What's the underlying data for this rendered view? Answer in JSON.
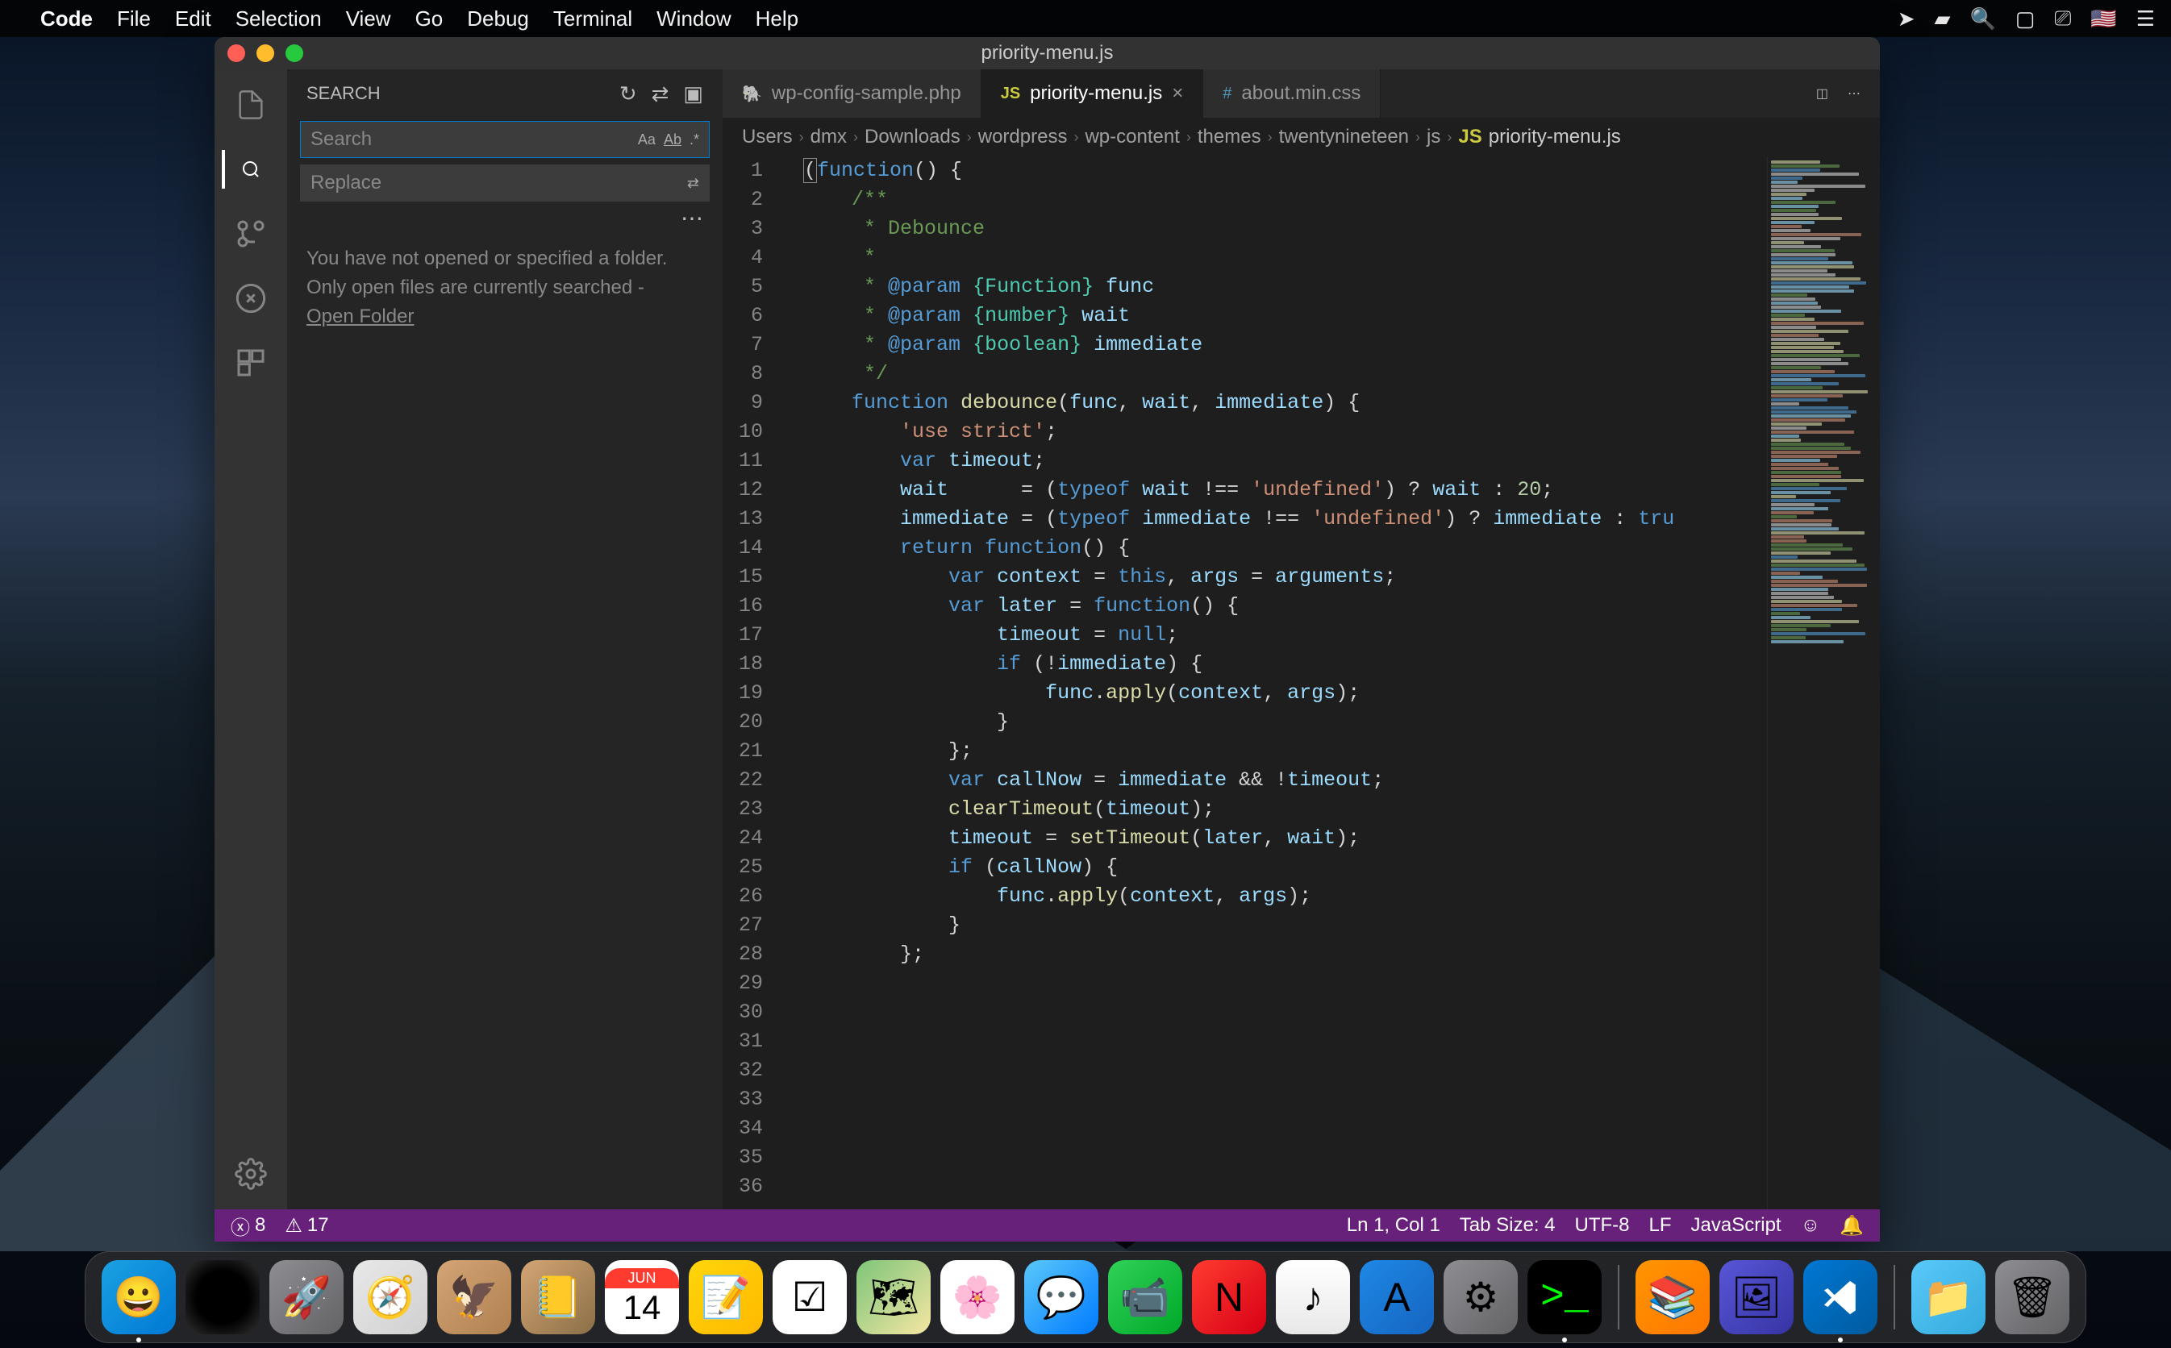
{
  "macos_menubar": {
    "app_name": "Code",
    "items": [
      "File",
      "Edit",
      "Selection",
      "View",
      "Go",
      "Debug",
      "Terminal",
      "Window",
      "Help"
    ]
  },
  "window": {
    "title": "priority-menu.js"
  },
  "sidebar": {
    "title": "SEARCH",
    "search_placeholder": "Search",
    "replace_placeholder": "Replace",
    "message_line1": "You have not opened or specified a folder.",
    "message_line2": "Only open files are currently searched -",
    "open_folder_link": "Open Folder"
  },
  "tabs": [
    {
      "icon": "php",
      "label": "wp-config-sample.php",
      "active": false
    },
    {
      "icon": "js",
      "label": "priority-menu.js",
      "active": true,
      "close": true
    },
    {
      "icon": "css",
      "label": "about.min.css",
      "active": false
    }
  ],
  "breadcrumbs": [
    "Users",
    "dmx",
    "Downloads",
    "wordpress",
    "wp-content",
    "themes",
    "twentynineteen",
    "js",
    "priority-menu.js"
  ],
  "breadcrumb_file_icon": "JS",
  "line_numbers": [
    "1",
    "2",
    "3",
    "4",
    "5",
    "6",
    "7",
    "8",
    "9",
    "10",
    "11",
    "12",
    "13",
    "14",
    "15",
    "16",
    "17",
    "18",
    "19",
    "20",
    "21",
    "22",
    "23",
    "24",
    "25",
    "26",
    "27",
    "28",
    "29",
    "30",
    "31",
    "32",
    "33",
    "34",
    "35",
    "36"
  ],
  "code_lines": [
    {
      "tokens": [
        {
          "t": "(",
          "c": "bracket-highlight"
        },
        {
          "t": "function",
          "c": "tok-keyword"
        },
        {
          "t": "() {",
          "c": ""
        }
      ]
    },
    {
      "tokens": [
        {
          "t": "",
          "c": ""
        }
      ]
    },
    {
      "tokens": [
        {
          "t": "    /**",
          "c": "tok-comment"
        }
      ]
    },
    {
      "tokens": [
        {
          "t": "     * Debounce",
          "c": "tok-comment"
        }
      ]
    },
    {
      "tokens": [
        {
          "t": "     *",
          "c": "tok-comment"
        }
      ]
    },
    {
      "tokens": [
        {
          "t": "     * ",
          "c": "tok-comment"
        },
        {
          "t": "@param",
          "c": "tok-keyword"
        },
        {
          "t": " ",
          "c": ""
        },
        {
          "t": "{Function}",
          "c": "tok-type"
        },
        {
          "t": " ",
          "c": ""
        },
        {
          "t": "func",
          "c": "tok-variable"
        }
      ]
    },
    {
      "tokens": [
        {
          "t": "     * ",
          "c": "tok-comment"
        },
        {
          "t": "@param",
          "c": "tok-keyword"
        },
        {
          "t": " ",
          "c": ""
        },
        {
          "t": "{number}",
          "c": "tok-type"
        },
        {
          "t": " ",
          "c": ""
        },
        {
          "t": "wait",
          "c": "tok-variable"
        }
      ]
    },
    {
      "tokens": [
        {
          "t": "     * ",
          "c": "tok-comment"
        },
        {
          "t": "@param",
          "c": "tok-keyword"
        },
        {
          "t": " ",
          "c": ""
        },
        {
          "t": "{boolean}",
          "c": "tok-type"
        },
        {
          "t": " ",
          "c": ""
        },
        {
          "t": "immediate",
          "c": "tok-variable"
        }
      ]
    },
    {
      "tokens": [
        {
          "t": "     */",
          "c": "tok-comment"
        }
      ]
    },
    {
      "tokens": [
        {
          "t": "    ",
          "c": ""
        },
        {
          "t": "function",
          "c": "tok-keyword"
        },
        {
          "t": " ",
          "c": ""
        },
        {
          "t": "debounce",
          "c": "tok-function"
        },
        {
          "t": "(",
          "c": ""
        },
        {
          "t": "func",
          "c": "tok-variable"
        },
        {
          "t": ", ",
          "c": ""
        },
        {
          "t": "wait",
          "c": "tok-variable"
        },
        {
          "t": ", ",
          "c": ""
        },
        {
          "t": "immediate",
          "c": "tok-variable"
        },
        {
          "t": ") {",
          "c": ""
        }
      ]
    },
    {
      "tokens": [
        {
          "t": "        ",
          "c": ""
        },
        {
          "t": "'use strict'",
          "c": "tok-string"
        },
        {
          "t": ";",
          "c": ""
        }
      ]
    },
    {
      "tokens": [
        {
          "t": "",
          "c": ""
        }
      ]
    },
    {
      "tokens": [
        {
          "t": "        ",
          "c": ""
        },
        {
          "t": "var",
          "c": "tok-keyword"
        },
        {
          "t": " ",
          "c": ""
        },
        {
          "t": "timeout",
          "c": "tok-variable"
        },
        {
          "t": ";",
          "c": ""
        }
      ]
    },
    {
      "tokens": [
        {
          "t": "        ",
          "c": ""
        },
        {
          "t": "wait",
          "c": "tok-variable"
        },
        {
          "t": "      = (",
          "c": ""
        },
        {
          "t": "typeof",
          "c": "tok-keyword"
        },
        {
          "t": " ",
          "c": ""
        },
        {
          "t": "wait",
          "c": "tok-variable"
        },
        {
          "t": " !== ",
          "c": ""
        },
        {
          "t": "'undefined'",
          "c": "tok-string"
        },
        {
          "t": ") ? ",
          "c": ""
        },
        {
          "t": "wait",
          "c": "tok-variable"
        },
        {
          "t": " : ",
          "c": ""
        },
        {
          "t": "20",
          "c": "tok-number"
        },
        {
          "t": ";",
          "c": ""
        }
      ]
    },
    {
      "tokens": [
        {
          "t": "        ",
          "c": ""
        },
        {
          "t": "immediate",
          "c": "tok-variable"
        },
        {
          "t": " = (",
          "c": ""
        },
        {
          "t": "typeof",
          "c": "tok-keyword"
        },
        {
          "t": " ",
          "c": ""
        },
        {
          "t": "immediate",
          "c": "tok-variable"
        },
        {
          "t": " !== ",
          "c": ""
        },
        {
          "t": "'undefined'",
          "c": "tok-string"
        },
        {
          "t": ") ? ",
          "c": ""
        },
        {
          "t": "immediate",
          "c": "tok-variable"
        },
        {
          "t": " : ",
          "c": ""
        },
        {
          "t": "tru",
          "c": "tok-keyword"
        }
      ]
    },
    {
      "tokens": [
        {
          "t": "",
          "c": ""
        }
      ]
    },
    {
      "tokens": [
        {
          "t": "        ",
          "c": ""
        },
        {
          "t": "return",
          "c": "tok-keyword"
        },
        {
          "t": " ",
          "c": ""
        },
        {
          "t": "function",
          "c": "tok-keyword"
        },
        {
          "t": "() {",
          "c": ""
        }
      ]
    },
    {
      "tokens": [
        {
          "t": "",
          "c": ""
        }
      ]
    },
    {
      "tokens": [
        {
          "t": "            ",
          "c": ""
        },
        {
          "t": "var",
          "c": "tok-keyword"
        },
        {
          "t": " ",
          "c": ""
        },
        {
          "t": "context",
          "c": "tok-variable"
        },
        {
          "t": " = ",
          "c": ""
        },
        {
          "t": "this",
          "c": "tok-keyword"
        },
        {
          "t": ", ",
          "c": ""
        },
        {
          "t": "args",
          "c": "tok-variable"
        },
        {
          "t": " = ",
          "c": ""
        },
        {
          "t": "arguments",
          "c": "tok-variable"
        },
        {
          "t": ";",
          "c": ""
        }
      ]
    },
    {
      "tokens": [
        {
          "t": "            ",
          "c": ""
        },
        {
          "t": "var",
          "c": "tok-keyword"
        },
        {
          "t": " ",
          "c": ""
        },
        {
          "t": "later",
          "c": "tok-variable"
        },
        {
          "t": " = ",
          "c": ""
        },
        {
          "t": "function",
          "c": "tok-keyword"
        },
        {
          "t": "() {",
          "c": ""
        }
      ]
    },
    {
      "tokens": [
        {
          "t": "                ",
          "c": ""
        },
        {
          "t": "timeout",
          "c": "tok-variable"
        },
        {
          "t": " = ",
          "c": ""
        },
        {
          "t": "null",
          "c": "tok-keyword"
        },
        {
          "t": ";",
          "c": ""
        }
      ]
    },
    {
      "tokens": [
        {
          "t": "",
          "c": ""
        }
      ]
    },
    {
      "tokens": [
        {
          "t": "                ",
          "c": ""
        },
        {
          "t": "if",
          "c": "tok-keyword"
        },
        {
          "t": " (!",
          "c": ""
        },
        {
          "t": "immediate",
          "c": "tok-variable"
        },
        {
          "t": ") {",
          "c": ""
        }
      ]
    },
    {
      "tokens": [
        {
          "t": "                    ",
          "c": ""
        },
        {
          "t": "func",
          "c": "tok-variable"
        },
        {
          "t": ".",
          "c": ""
        },
        {
          "t": "apply",
          "c": "tok-function"
        },
        {
          "t": "(",
          "c": ""
        },
        {
          "t": "context",
          "c": "tok-variable"
        },
        {
          "t": ", ",
          "c": ""
        },
        {
          "t": "args",
          "c": "tok-variable"
        },
        {
          "t": ");",
          "c": ""
        }
      ]
    },
    {
      "tokens": [
        {
          "t": "                }",
          "c": ""
        }
      ]
    },
    {
      "tokens": [
        {
          "t": "            };",
          "c": ""
        }
      ]
    },
    {
      "tokens": [
        {
          "t": "",
          "c": ""
        }
      ]
    },
    {
      "tokens": [
        {
          "t": "            ",
          "c": ""
        },
        {
          "t": "var",
          "c": "tok-keyword"
        },
        {
          "t": " ",
          "c": ""
        },
        {
          "t": "callNow",
          "c": "tok-variable"
        },
        {
          "t": " = ",
          "c": ""
        },
        {
          "t": "immediate",
          "c": "tok-variable"
        },
        {
          "t": " && !",
          "c": ""
        },
        {
          "t": "timeout",
          "c": "tok-variable"
        },
        {
          "t": ";",
          "c": ""
        }
      ]
    },
    {
      "tokens": [
        {
          "t": "",
          "c": ""
        }
      ]
    },
    {
      "tokens": [
        {
          "t": "            ",
          "c": ""
        },
        {
          "t": "clearTimeout",
          "c": "tok-function"
        },
        {
          "t": "(",
          "c": ""
        },
        {
          "t": "timeout",
          "c": "tok-variable"
        },
        {
          "t": ");",
          "c": ""
        }
      ]
    },
    {
      "tokens": [
        {
          "t": "            ",
          "c": ""
        },
        {
          "t": "timeout",
          "c": "tok-variable"
        },
        {
          "t": " = ",
          "c": ""
        },
        {
          "t": "setTimeout",
          "c": "tok-function"
        },
        {
          "t": "(",
          "c": ""
        },
        {
          "t": "later",
          "c": "tok-variable"
        },
        {
          "t": ", ",
          "c": ""
        },
        {
          "t": "wait",
          "c": "tok-variable"
        },
        {
          "t": ");",
          "c": ""
        }
      ]
    },
    {
      "tokens": [
        {
          "t": "",
          "c": ""
        }
      ]
    },
    {
      "tokens": [
        {
          "t": "            ",
          "c": ""
        },
        {
          "t": "if",
          "c": "tok-keyword"
        },
        {
          "t": " (",
          "c": ""
        },
        {
          "t": "callNow",
          "c": "tok-variable"
        },
        {
          "t": ") {",
          "c": ""
        }
      ]
    },
    {
      "tokens": [
        {
          "t": "                ",
          "c": ""
        },
        {
          "t": "func",
          "c": "tok-variable"
        },
        {
          "t": ".",
          "c": ""
        },
        {
          "t": "apply",
          "c": "tok-function"
        },
        {
          "t": "(",
          "c": ""
        },
        {
          "t": "context",
          "c": "tok-variable"
        },
        {
          "t": ", ",
          "c": ""
        },
        {
          "t": "args",
          "c": "tok-variable"
        },
        {
          "t": ");",
          "c": ""
        }
      ]
    },
    {
      "tokens": [
        {
          "t": "            }",
          "c": ""
        }
      ]
    },
    {
      "tokens": [
        {
          "t": "        };",
          "c": ""
        }
      ]
    }
  ],
  "status_bar": {
    "errors": "8",
    "warnings": "17",
    "line_col": "Ln 1, Col 1",
    "tab_size": "Tab Size: 4",
    "encoding": "UTF-8",
    "eol": "LF",
    "language": "JavaScript"
  },
  "dock": {
    "calendar_month": "JUN",
    "calendar_day": "14",
    "apps": [
      "finder",
      "siri",
      "launchpad",
      "safari",
      "mail",
      "contacts",
      "calendar",
      "notes",
      "reminders",
      "maps",
      "photos",
      "messages",
      "facetime",
      "news",
      "itunes",
      "appstore",
      "settings",
      "terminal"
    ],
    "right_apps": [
      "books",
      "preview",
      "vscode"
    ],
    "system": [
      "folder",
      "trash"
    ]
  }
}
